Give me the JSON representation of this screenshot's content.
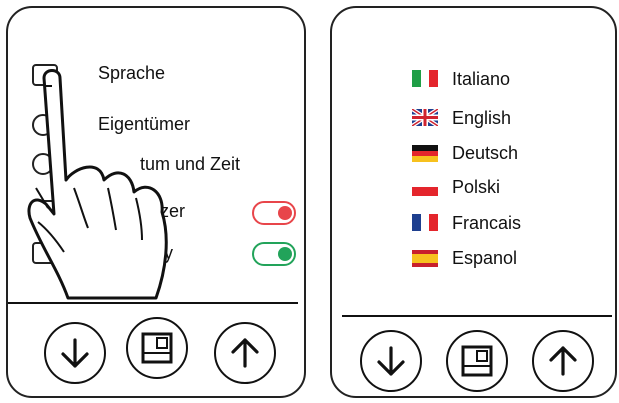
{
  "left_panel": {
    "menu": [
      {
        "label": "Sprache",
        "icon": "language-icon"
      },
      {
        "label": "Eigentümer",
        "icon": "owner-icon"
      },
      {
        "label": "tum und Zeit",
        "icon": "clock-icon"
      },
      {
        "label": "zer",
        "icon": "buzzer-icon",
        "toggle": "off"
      },
      {
        "label": "by",
        "icon": "standby-icon",
        "toggle": "on"
      }
    ],
    "toggle_colors": {
      "off": "#e8454a",
      "on": "#22a35a"
    }
  },
  "right_panel": {
    "languages": [
      {
        "label": "Italiano",
        "flag": "italy-flag"
      },
      {
        "label": "English",
        "flag": "uk-flag"
      },
      {
        "label": "Deutsch",
        "flag": "germany-flag"
      },
      {
        "label": "Polski",
        "flag": "poland-flag"
      },
      {
        "label": "Francais",
        "flag": "france-flag"
      },
      {
        "label": "Espanol",
        "flag": "spain-flag"
      }
    ]
  },
  "nav_buttons": [
    "down-arrow-icon",
    "home-icon",
    "up-arrow-icon"
  ]
}
